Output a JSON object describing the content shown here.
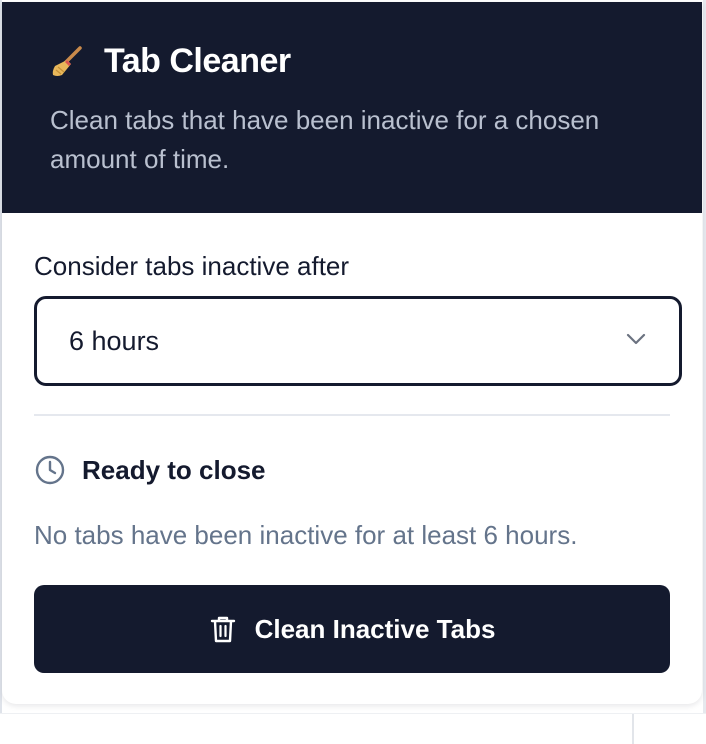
{
  "header": {
    "title": "Tab Cleaner",
    "subtitle": "Clean tabs that have been inactive for a chosen amount of time.",
    "icon": "broom-icon"
  },
  "inactivity": {
    "label": "Consider tabs inactive after",
    "selected": "6 hours",
    "chevron_icon": "chevron-down-icon"
  },
  "status": {
    "icon": "clock-icon",
    "title": "Ready to close",
    "message": "No tabs have been inactive for at least 6 hours."
  },
  "action": {
    "icon": "trash-icon",
    "label": "Clean Inactive Tabs"
  },
  "colors": {
    "header_bg": "#141a2e",
    "button_bg": "#141a2e",
    "muted_text": "#64748b",
    "subtitle_text": "#b9c0cf"
  }
}
